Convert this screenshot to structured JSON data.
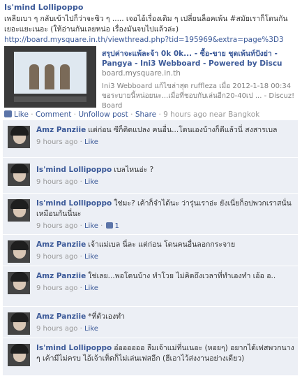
{
  "post": {
    "author": "Is'mind Lollipoppo",
    "message": "เพลียเบา ๆ กลับเข้าไปก็ว่าจะซิว ๆ ..... เจอไอ้เรื่องเดิม ๆ เปลี่ยนล็อคเพ้น #สมัยเราก็โดนกันเยอะแยะเนอะ (ให้อ่านกันเลยหน่อ เรื่องมันจบไปแล้วล่ะ)",
    "url": "http://board.mysquare.in.th/viewthread.php?tid=195969&extra=page%3D3"
  },
  "attachment": {
    "title": "สรุปค่าจะแพ้ละจ้า 0k 0k... - ซื้อ-ขาย ชุดเพ้นท์ปังย่า - Pangya - Ini3 Webboard - Powered by Discu",
    "domain": "board.mysquare.in.th",
    "description": "Ini3 Webboard แก้ไขล่าสุด ruffleza เมื่อ 2012-1-18 00:34 ขอระบายนี้หน่อยนะ...เมื่อที่ชอบกับเล่นอีก20-40เป ... - Discuz! Board"
  },
  "actions": {
    "like": "Like",
    "comment": "Comment",
    "unfollow": "Unfollow post",
    "share": "Share",
    "time": "9 hours ago near Bangkok",
    "sep": "·"
  },
  "comments": [
    {
      "name": "Amz Panziie",
      "text": "แต่ก่อน ซีก็ติดแปลง คนอื่น...โดนเองบ้างก็ดีแล้วนี่ สงสารเบล",
      "time": "9 hours ago",
      "like": "Like",
      "likes": ""
    },
    {
      "name": "Is'mind Lollipoppo",
      "text": "เบลไหนอ่ะ ?",
      "time": "9 hours ago",
      "like": "Like",
      "likes": ""
    },
    {
      "name": "Is'mind Lollipoppo",
      "text": "ใช่มะ? เค้าก็จำได้นะ ว่ารุ่นเราอ่ะ ยังเนี่ยก็อปพวกเราสนั่นเหมือนกันนี่นะ",
      "time": "9 hours ago",
      "like": "Like",
      "likes": "1"
    },
    {
      "name": "Amz Panziie",
      "text": "เจ้าแม่เบล นี่ละ แต่ก่อน โดนคนอื่นลอกกระจาย",
      "time": "9 hours ago",
      "like": "Like",
      "likes": ""
    },
    {
      "name": "Amz Panziie",
      "text": "ใช่เลย...พอโดนบ้าง ทำโวย ไม่คิดถึงเวลาที่ทำเองทำ เอ้อ อ..",
      "time": "9 hours ago",
      "like": "Like",
      "likes": ""
    },
    {
      "name": "Amz Panziie",
      "text": "*ที่ตัวเองทำ",
      "time": "9 hours ago",
      "like": "Like",
      "likes": ""
    },
    {
      "name": "Is'mind Lollipoppo",
      "text": "อ๋ออออออ ลืมเจ้าแม่ที่นเนอะ (หอยๆ) อยากได้เฟสพวกนาง ๆ เค้ามีไม่ครบ ไอ้เจ้าเท็ดก็ไม่เล่นเฟสอีก (ฮีเอาไว้ส่งงานอย่างเดียว)",
      "time": "",
      "like": "",
      "likes": ""
    }
  ]
}
